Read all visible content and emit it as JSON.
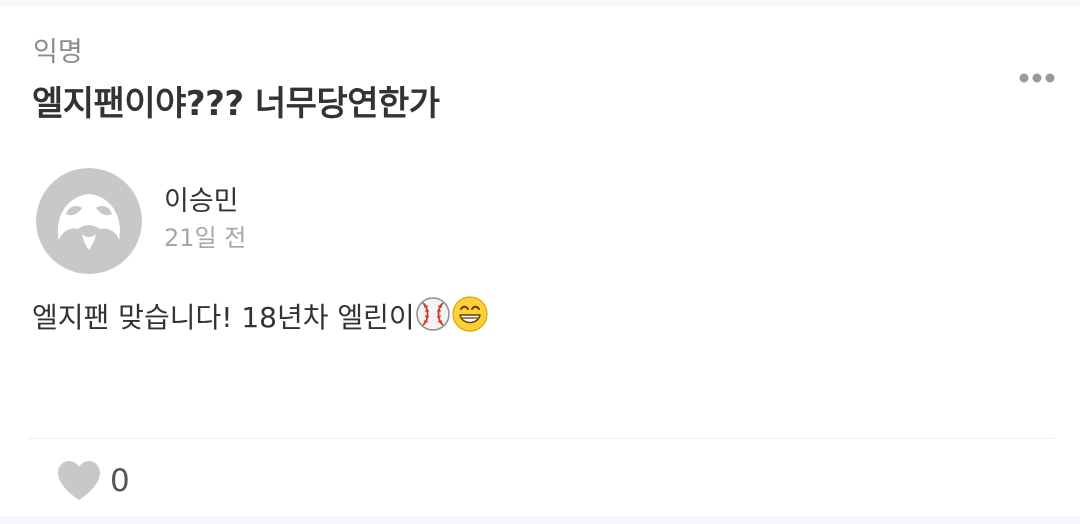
{
  "post": {
    "category": "익명",
    "title": "엘지팬이야??? 너무당연한가"
  },
  "comment": {
    "author": "이승민",
    "time": "21일 전",
    "text": "엘지팬 맞습니다! 18년차 엘린이",
    "emojis": [
      "baseball-icon",
      "grinning-face-icon"
    ],
    "avatar": "default-avatar-icon"
  },
  "likes": {
    "count": "0",
    "icon": "heart-icon"
  },
  "menu": {
    "icon": "more-options-icon"
  },
  "colors": {
    "text": "#333333",
    "muted": "#8b8b8b",
    "avatar_bg": "#c8c8c8",
    "heart": "#c8c8c8",
    "background": "#ffffff"
  }
}
